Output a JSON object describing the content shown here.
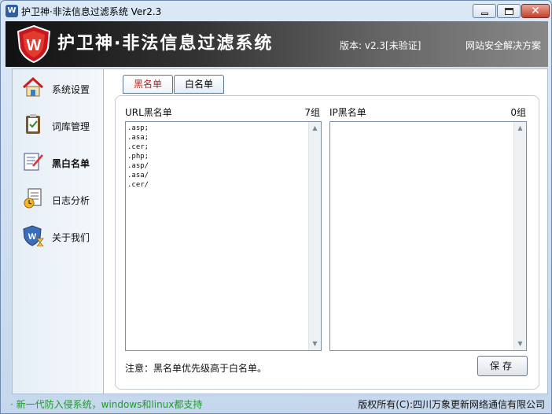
{
  "window": {
    "title": "护卫神·非法信息过滤系统 Ver2.3",
    "icon": "shield-app-icon",
    "controls": [
      "minimize-icon",
      "maximize-icon",
      "close-icon"
    ]
  },
  "banner": {
    "app_name": "护卫神·非法信息过滤系统",
    "version": "版本: v2.3[未验证]",
    "slogan": "网站安全解决方案",
    "logo_letter": "W"
  },
  "sidebar": {
    "items": [
      {
        "label": "系统设置",
        "icon": "house-icon",
        "active": false
      },
      {
        "label": "词库管理",
        "icon": "clipboard-icon",
        "active": false
      },
      {
        "label": "黑白名单",
        "icon": "checklist-icon",
        "active": true
      },
      {
        "label": "日志分析",
        "icon": "report-clock-icon",
        "active": false
      },
      {
        "label": "关于我们",
        "icon": "shield-hourglass-icon",
        "active": false
      }
    ]
  },
  "tabs": {
    "blacklist": "黑名单",
    "whitelist": "白名单",
    "active": "blacklist"
  },
  "url_list": {
    "title": "URL黑名单",
    "count": "7组",
    "items": [
      ".asp;",
      ".asa;",
      ".cer;",
      ".php;",
      ".asp/",
      ".asa/",
      ".cer/"
    ]
  },
  "ip_list": {
    "title": "IP黑名单",
    "count": "0组",
    "items": []
  },
  "note": "注意：黑名单优先级高于白名单。",
  "save_label": "保存",
  "status": {
    "left": "· 新一代防入侵系统，windows和linux都支持",
    "right": "版权所有(C):四川万象更新网络通信有限公司"
  },
  "colors": {
    "status_green": "#1e9a2a",
    "active_tab_red": "#c0201a",
    "logo_red": "#c8171c"
  }
}
